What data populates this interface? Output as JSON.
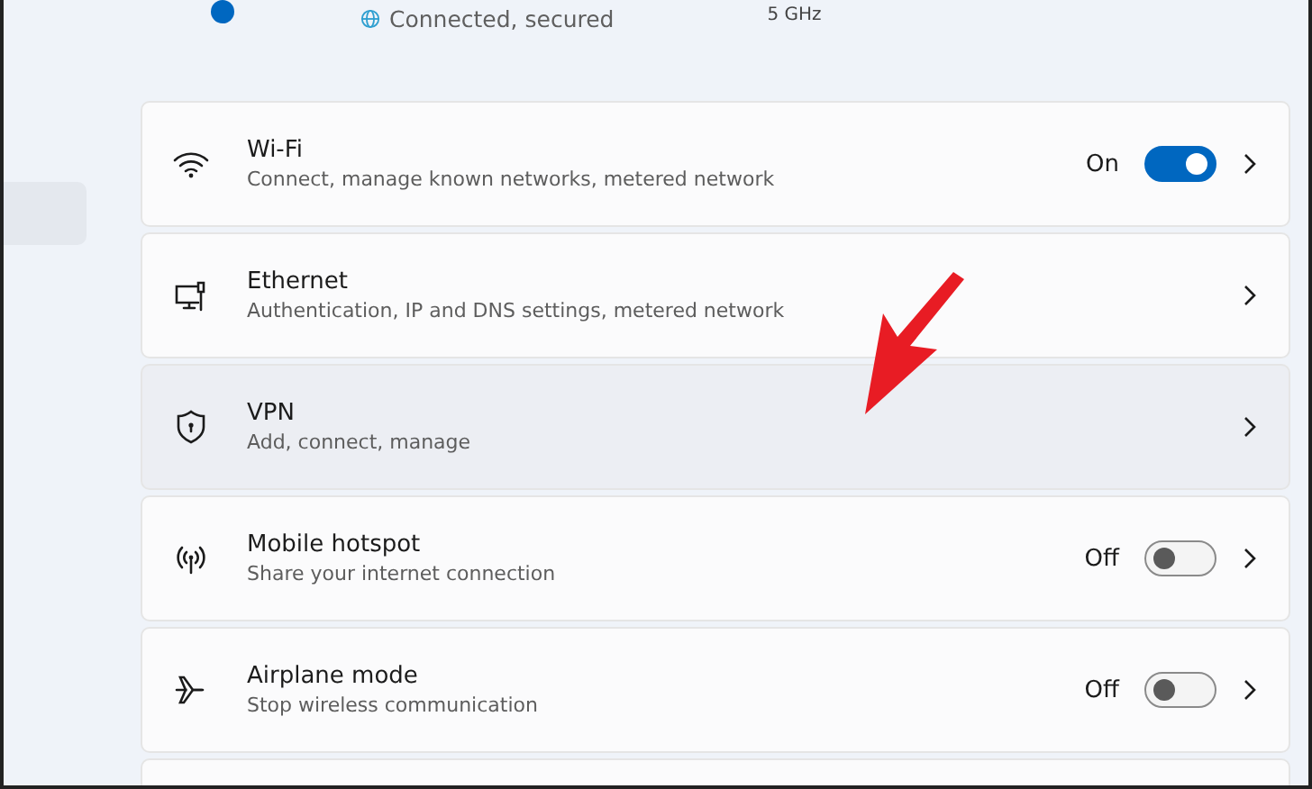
{
  "header": {
    "status": "Connected, secured",
    "band": "5 GHz"
  },
  "settings": [
    {
      "kind": "toggle",
      "title": "Wi-Fi",
      "subtitle": "Connect, manage known networks, metered network",
      "status": "On",
      "on": true,
      "hovered": false
    },
    {
      "kind": "link",
      "title": "Ethernet",
      "subtitle": "Authentication, IP and DNS settings, metered network",
      "hovered": false
    },
    {
      "kind": "link",
      "title": "VPN",
      "subtitle": "Add, connect, manage",
      "hovered": true
    },
    {
      "kind": "toggle",
      "title": "Mobile hotspot",
      "subtitle": "Share your internet connection",
      "status": "Off",
      "on": false,
      "hovered": false
    },
    {
      "kind": "toggle",
      "title": "Airplane mode",
      "subtitle": "Stop wireless communication",
      "status": "Off",
      "on": false,
      "hovered": false
    },
    {
      "kind": "empty"
    }
  ]
}
